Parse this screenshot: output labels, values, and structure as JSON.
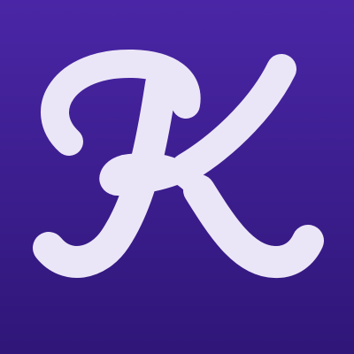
{
  "logo": {
    "name": "script-k-logo",
    "letter": "K",
    "background_top": "#4a26a6",
    "background_bottom": "#2f1678",
    "glyph_color": "#ebe6f7"
  }
}
